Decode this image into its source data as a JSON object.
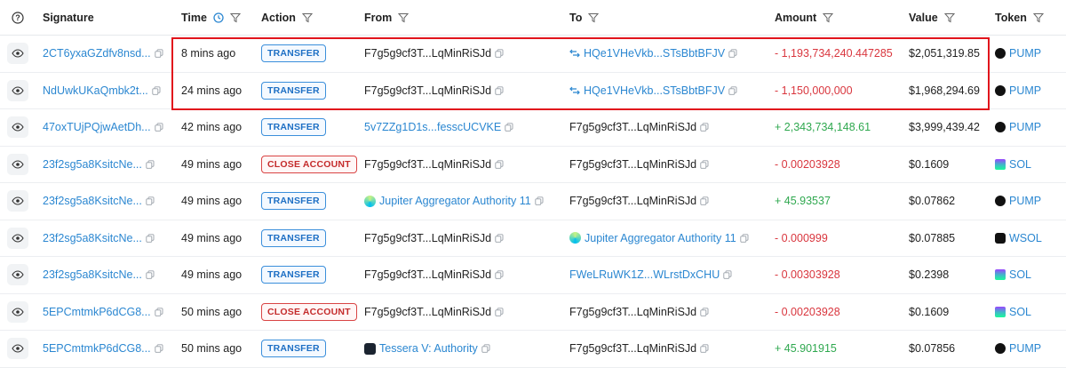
{
  "headers": {
    "signature": "Signature",
    "time": "Time",
    "action": "Action",
    "from": "From",
    "to": "To",
    "amount": "Amount",
    "value": "Value",
    "token": "Token"
  },
  "rows": [
    {
      "signature": "2CT6yxaGZdfv8nsd...",
      "time": "8 mins ago",
      "action": "TRANSFER",
      "action_type": "transfer",
      "from": "F7g5g9cf3T...LqMinRiSJd",
      "from_icon": "",
      "from_link": false,
      "to": "HQe1VHeVkb...STsBbtBFJV",
      "to_icon": "swap",
      "to_link": true,
      "amount": "- 1,193,734,240.447285",
      "amount_sign": "neg",
      "value": "$2,051,319.85",
      "token": "PUMP",
      "token_icon": "pump"
    },
    {
      "signature": "NdUwkUKaQmbk2t...",
      "time": "24 mins ago",
      "action": "TRANSFER",
      "action_type": "transfer",
      "from": "F7g5g9cf3T...LqMinRiSJd",
      "from_icon": "",
      "from_link": false,
      "to": "HQe1VHeVkb...STsBbtBFJV",
      "to_icon": "swap",
      "to_link": true,
      "amount": "- 1,150,000,000",
      "amount_sign": "neg",
      "value": "$1,968,294.69",
      "token": "PUMP",
      "token_icon": "pump"
    },
    {
      "signature": "47oxTUjPQjwAetDh...",
      "time": "42 mins ago",
      "action": "TRANSFER",
      "action_type": "transfer",
      "from": "5v7ZZg1D1s...fesscUCVKE",
      "from_icon": "",
      "from_link": true,
      "to": "F7g5g9cf3T...LqMinRiSJd",
      "to_icon": "",
      "to_link": false,
      "amount": "+ 2,343,734,148.61",
      "amount_sign": "pos",
      "value": "$3,999,439.42",
      "token": "PUMP",
      "token_icon": "pump"
    },
    {
      "signature": "23f2sg5a8KsitcNe...",
      "time": "49 mins ago",
      "action": "CLOSE ACCOUNT",
      "action_type": "close",
      "from": "F7g5g9cf3T...LqMinRiSJd",
      "from_icon": "",
      "from_link": false,
      "to": "F7g5g9cf3T...LqMinRiSJd",
      "to_icon": "",
      "to_link": false,
      "amount": "- 0.00203928",
      "amount_sign": "neg",
      "value": "$0.1609",
      "token": "SOL",
      "token_icon": "sol"
    },
    {
      "signature": "23f2sg5a8KsitcNe...",
      "time": "49 mins ago",
      "action": "TRANSFER",
      "action_type": "transfer",
      "from": "Jupiter Aggregator Authority 11",
      "from_icon": "jup",
      "from_link": true,
      "to": "F7g5g9cf3T...LqMinRiSJd",
      "to_icon": "",
      "to_link": false,
      "amount": "+ 45.93537",
      "amount_sign": "pos",
      "value": "$0.07862",
      "token": "PUMP",
      "token_icon": "pump"
    },
    {
      "signature": "23f2sg5a8KsitcNe...",
      "time": "49 mins ago",
      "action": "TRANSFER",
      "action_type": "transfer",
      "from": "F7g5g9cf3T...LqMinRiSJd",
      "from_icon": "",
      "from_link": false,
      "to": "Jupiter Aggregator Authority 11",
      "to_icon": "jup",
      "to_link": true,
      "amount": "- 0.000999",
      "amount_sign": "neg",
      "value": "$0.07885",
      "token": "WSOL",
      "token_icon": "wsol"
    },
    {
      "signature": "23f2sg5a8KsitcNe...",
      "time": "49 mins ago",
      "action": "TRANSFER",
      "action_type": "transfer",
      "from": "F7g5g9cf3T...LqMinRiSJd",
      "from_icon": "",
      "from_link": false,
      "to": "FWeLRuWK1Z...WLrstDxCHU",
      "to_icon": "",
      "to_link": true,
      "amount": "- 0.00303928",
      "amount_sign": "neg",
      "value": "$0.2398",
      "token": "SOL",
      "token_icon": "sol"
    },
    {
      "signature": "5EPCmtmkP6dCG8...",
      "time": "50 mins ago",
      "action": "CLOSE ACCOUNT",
      "action_type": "close",
      "from": "F7g5g9cf3T...LqMinRiSJd",
      "from_icon": "",
      "from_link": false,
      "to": "F7g5g9cf3T...LqMinRiSJd",
      "to_icon": "",
      "to_link": false,
      "amount": "- 0.00203928",
      "amount_sign": "neg",
      "value": "$0.1609",
      "token": "SOL",
      "token_icon": "sol"
    },
    {
      "signature": "5EPCmtmkP6dCG8...",
      "time": "50 mins ago",
      "action": "TRANSFER",
      "action_type": "transfer",
      "from": "Tessera V: Authority",
      "from_icon": "tess",
      "from_link": true,
      "to": "F7g5g9cf3T...LqMinRiSJd",
      "to_icon": "",
      "to_link": false,
      "amount": "+ 45.901915",
      "amount_sign": "pos",
      "value": "$0.07856",
      "token": "PUMP",
      "token_icon": "pump"
    }
  ],
  "colors": {
    "link": "#2b87d1",
    "negative": "#d9363e",
    "positive": "#2fa84f",
    "highlight": "#e1141c"
  }
}
